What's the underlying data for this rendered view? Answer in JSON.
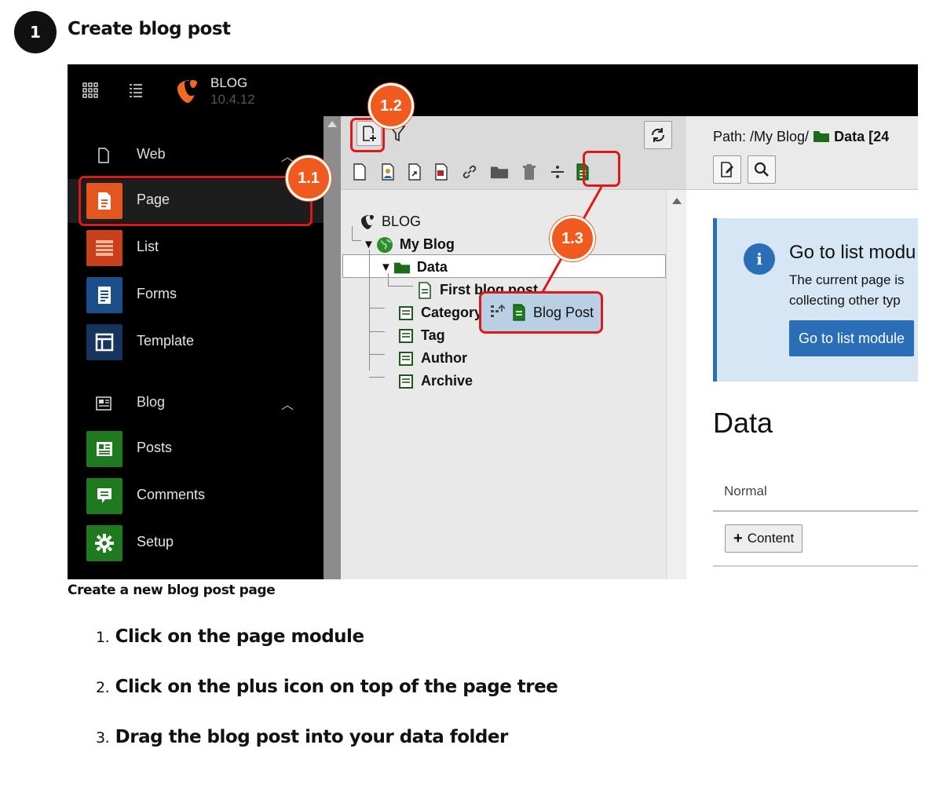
{
  "step": {
    "number": "1",
    "title": "Create blog post"
  },
  "topbar": {
    "brand": "BLOG",
    "version": "10.4.12"
  },
  "modules": {
    "web_group": "Web",
    "web_items": [
      {
        "label": "Page",
        "color": "#e5551f"
      },
      {
        "label": "List",
        "color": "#c8401a"
      },
      {
        "label": "Forms",
        "color": "#1a4f8c"
      },
      {
        "label": "Template",
        "color": "#15355e"
      }
    ],
    "blog_group": "Blog",
    "blog_items": [
      {
        "label": "Posts",
        "color": "#1f7a1f"
      },
      {
        "label": "Comments",
        "color": "#1f7a1f"
      },
      {
        "label": "Setup",
        "color": "#1f7a1f"
      }
    ]
  },
  "tree": {
    "root": "BLOG",
    "site": "My Blog",
    "folder": "Data",
    "child": "First blog post",
    "pages": [
      "Category",
      "Tag",
      "Author",
      "Archive"
    ],
    "drag_label": "Blog Post"
  },
  "doc": {
    "path_prefix": "Path: /My Blog/",
    "path_page": "Data [24",
    "info_title": "Go to list modu",
    "info_line1": "The current page is",
    "info_line2": "collecting other typ",
    "info_button": "Go to list module",
    "heading": "Data",
    "column": "Normal",
    "content_button": "Content"
  },
  "callouts": {
    "c11": "1.1",
    "c12": "1.2",
    "c13": "1.3"
  },
  "caption": "Create a new blog post page",
  "instructions": [
    {
      "num": "1.",
      "text": "Click on the page module"
    },
    {
      "num": "2.",
      "text": "Click on the plus icon on top of the page tree"
    },
    {
      "num": "3.",
      "text": "Drag the blog post into your data folder"
    }
  ]
}
